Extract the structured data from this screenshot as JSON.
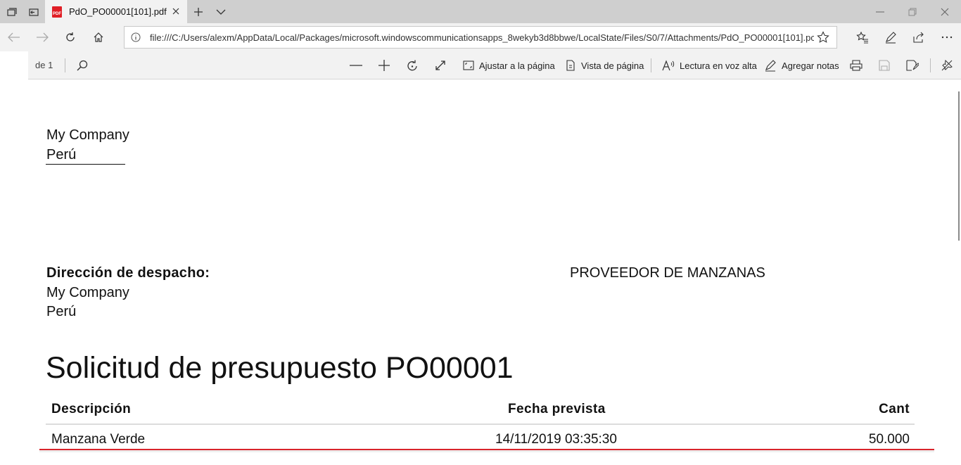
{
  "browser": {
    "tab": {
      "title": "PdO_PO00001[101].pdf",
      "pdf_badge": "PDF"
    },
    "address": {
      "url": "file:///C:/Users/alexm/AppData/Local/Packages/microsoft.windowscommunicationsapps_8wekyb3d8bbwe/LocalState/Files/S0/7/Attachments/PdO_PO00001[101].pc"
    }
  },
  "pdf_toolbar": {
    "page_current": "",
    "page_of": "de 1",
    "fit_page_label": "Ajustar a la página",
    "page_view_label": "Vista de página",
    "read_aloud_label": "Lectura en voz alta",
    "add_notes_label": "Agregar notas"
  },
  "document": {
    "company_name": "My Company",
    "company_country": "Perú",
    "shipping_label": "Dirección de despacho:",
    "shipping_company": "My Company",
    "shipping_country": "Perú",
    "vendor": "PROVEEDOR DE MANZANAS",
    "title": "Solicitud de presupuesto PO00001",
    "table": {
      "headers": [
        "Descripción",
        "Fecha prevista",
        "Cant"
      ],
      "rows": [
        [
          "Manzana Verde",
          "14/11/2019 03:35:30",
          "50.000"
        ]
      ]
    }
  },
  "colors": {
    "row_underline": "#d9242b",
    "pdf_icon": "#e01f26"
  }
}
